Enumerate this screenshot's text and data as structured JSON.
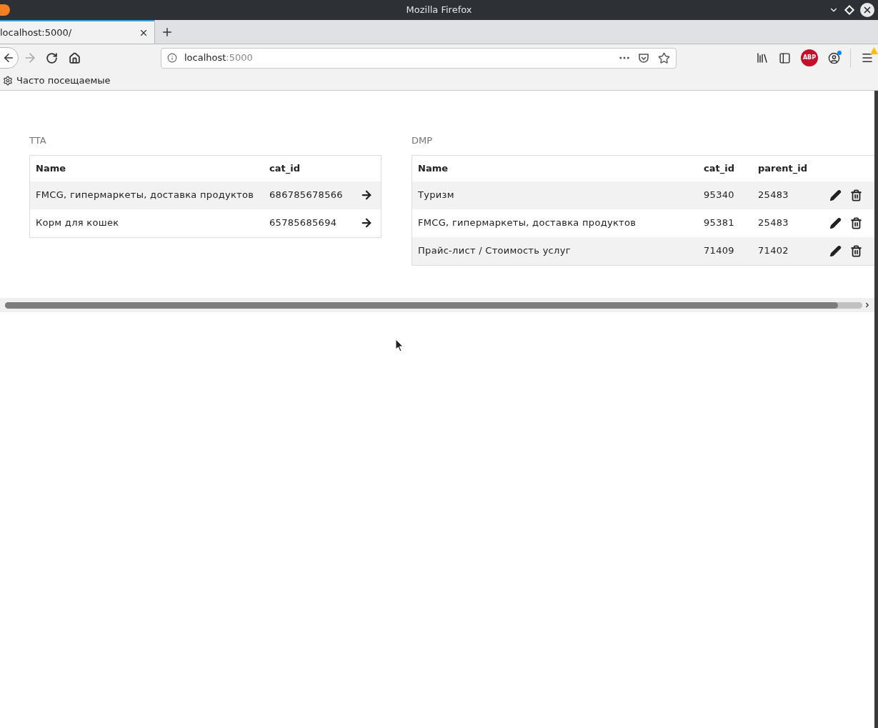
{
  "window": {
    "title": "Mozilla Firefox"
  },
  "tabs": [
    {
      "label": "localhost:5000/",
      "selected": true
    }
  ],
  "address_bar": {
    "host": "localhost",
    "port": ":5000"
  },
  "toolbar": {
    "adblock_label": "ABP"
  },
  "bookmarks": [
    {
      "label": "Часто посещаемые"
    }
  ],
  "panels": [
    {
      "title": "TTA",
      "kind": "link",
      "columns": [
        "Name",
        "cat_id"
      ],
      "rows": [
        {
          "cells": [
            "FMCG, гипермаркеты, доставка продуктов",
            "686785678566"
          ]
        },
        {
          "cells": [
            "Корм для кошек",
            "65785685694"
          ]
        }
      ]
    },
    {
      "title": "DMP",
      "kind": "edit",
      "columns": [
        "Name",
        "cat_id",
        "parent_id"
      ],
      "rows": [
        {
          "cells": [
            "Туризм",
            "95340",
            "25483"
          ]
        },
        {
          "cells": [
            "FMCG, гипермаркеты, доставка продуктов",
            "95381",
            "25483"
          ]
        },
        {
          "cells": [
            "Прайс-лист / Стоимость услуг",
            "71409",
            "71402"
          ]
        }
      ]
    }
  ]
}
